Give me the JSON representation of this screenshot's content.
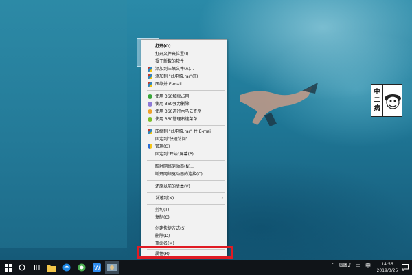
{
  "context_menu": {
    "items": [
      {
        "label": "打开(O)",
        "bold": true,
        "icon": "none"
      },
      {
        "label": "打开文件夹位置(I)",
        "icon": "none"
      },
      {
        "label": "授于新数的软件",
        "icon": "none"
      },
      {
        "label": "添加到压缩文件(A)...",
        "icon": "rar-icon"
      },
      {
        "label": "添加到 \"此电脑.rar\"(T)",
        "icon": "rar-icon"
      },
      {
        "label": "压缩并 E-mail...",
        "icon": "rar-icon"
      },
      {
        "label": "使用 360解除占用",
        "icon": "360-green-icon"
      },
      {
        "label": "使用 360强力删除",
        "icon": "360-purple-icon"
      },
      {
        "label": "使用 360进行木马云查杀",
        "icon": "360-orange-icon"
      },
      {
        "label": "使用 360管理右键菜单",
        "icon": "360-lime-icon"
      },
      {
        "label": "压缩到 \"此电脑.rar\" 并 E-mail",
        "icon": "rar-icon"
      },
      {
        "label": "固定到\"快速访问\"",
        "icon": "none"
      },
      {
        "label": "管理(G)",
        "icon": "shield-icon"
      },
      {
        "label": "固定到\"开始\"屏幕(P)",
        "icon": "none"
      },
      {
        "label": "映射网络驱动器(N)...",
        "icon": "none"
      },
      {
        "label": "断开网络驱动器的连接(C)...",
        "icon": "none"
      },
      {
        "label": "还原以前的版本(V)",
        "icon": "none"
      },
      {
        "label": "发送到(N)",
        "icon": "none",
        "submenu": true
      },
      {
        "label": "剪切(T)",
        "icon": "none"
      },
      {
        "label": "复制(C)",
        "icon": "none"
      },
      {
        "label": "创建快捷方式(S)",
        "icon": "none"
      },
      {
        "label": "删除(D)",
        "icon": "none"
      },
      {
        "label": "重命名(M)",
        "icon": "none"
      },
      {
        "label": "属性(R)",
        "icon": "none"
      }
    ],
    "submenu_arrow": "›"
  },
  "sticker": {
    "chars": [
      "中",
      "二",
      "病"
    ]
  },
  "taskbar": {
    "start_icon": "windows-logo-icon",
    "clock_time": "14:56",
    "clock_date": "2019/3/25",
    "tray_lang": "中",
    "tray_glyphs": [
      "⌃",
      "⌨",
      "♪",
      "▭"
    ]
  },
  "colors": {
    "highlight_border": "#e01b24",
    "menu_bg": "#f2f2f2"
  }
}
